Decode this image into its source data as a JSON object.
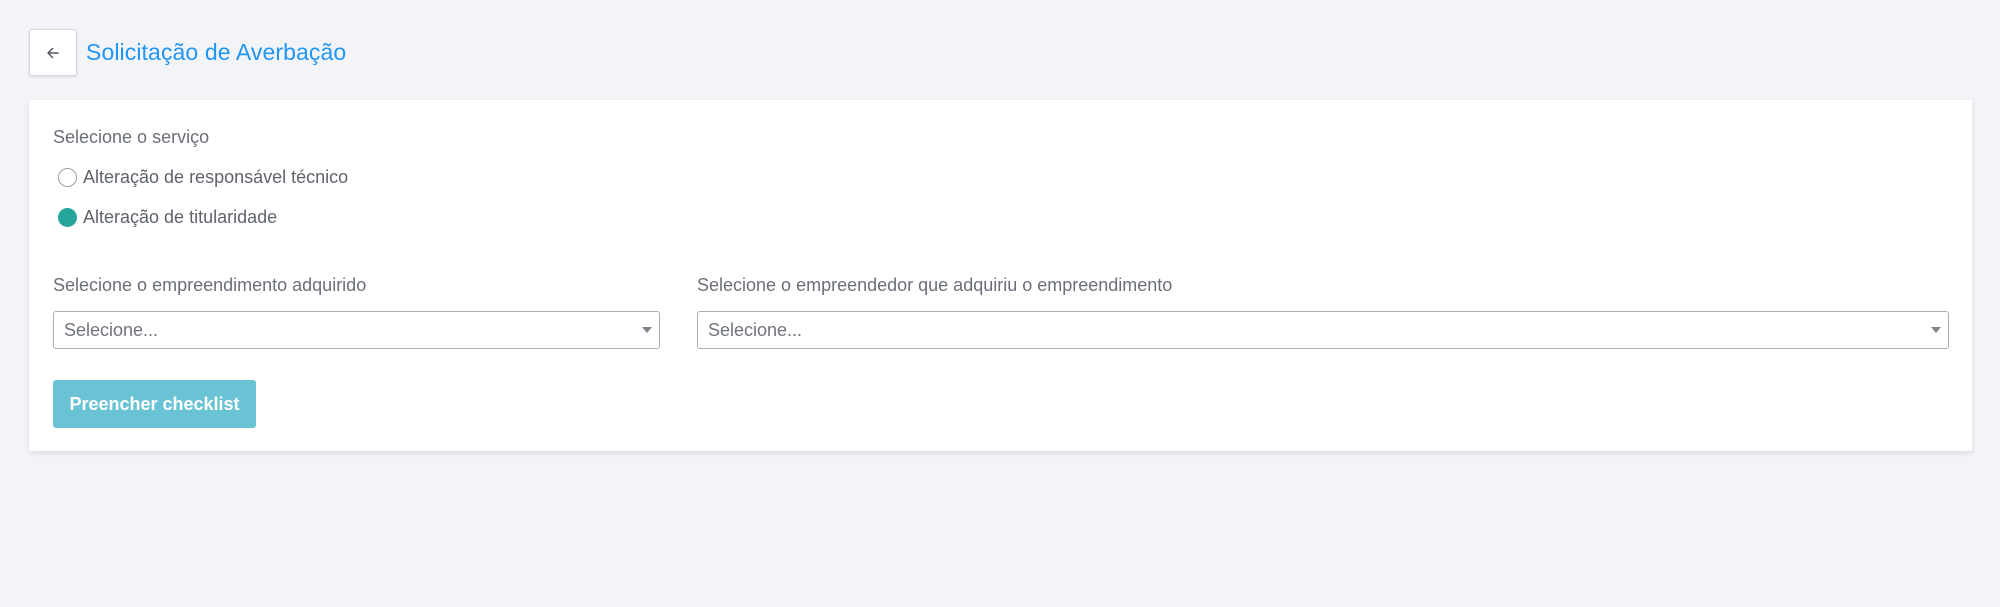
{
  "header": {
    "back_icon": "arrow-left-icon",
    "title": "Solicitação de Averbação"
  },
  "form": {
    "service_label": "Selecione o serviço",
    "service_options": [
      {
        "label": "Alteração de responsável técnico",
        "selected": false
      },
      {
        "label": "Alteração de titularidade",
        "selected": true
      }
    ],
    "enterprise_label": "Selecione o empreendimento adquirido",
    "enterprise_placeholder": "Selecione...",
    "entrepreneur_label": "Selecione o empreendedor que adquiriu o empreendimento",
    "entrepreneur_placeholder": "Selecione...",
    "submit_label": "Preencher checklist"
  },
  "colors": {
    "title": "#2196f3",
    "radio_checked": "#26a69a",
    "button": "#6ac3d4",
    "background": "#f3f4f8"
  }
}
